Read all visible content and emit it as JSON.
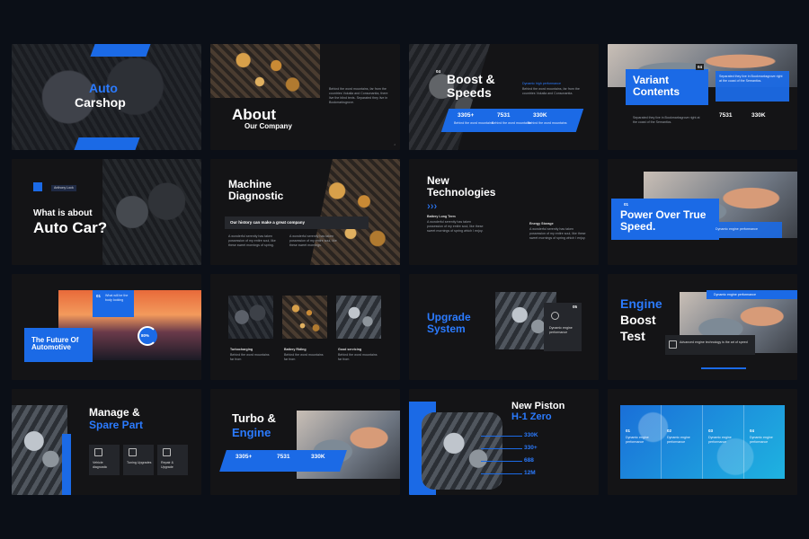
{
  "slides": {
    "s1": {
      "title1": "Auto",
      "title2": "Carshop"
    },
    "s2": {
      "title1": "About",
      "title2": "Our Company",
      "body": "Behind the word mountains, far from the countries Vokalia and Consonantia, there live the blind texts. Separated they live in Bookmarksgrove."
    },
    "s3": {
      "num": "04",
      "title": "Boost & Speeds",
      "sub": "Dynamic high performance",
      "body": "Behind the word mountains, far from the countries Vokalia and Consonantia.",
      "stats": [
        {
          "value": "3305+",
          "desc": "Behind the word mountains"
        },
        {
          "value": "7531",
          "desc": "Behind the word mountains"
        },
        {
          "value": "330K",
          "desc": "Behind the word mountains"
        }
      ]
    },
    "s4": {
      "num": "04",
      "title": "Variant Contents",
      "body": "Separated they live in Bookmarksgrove right at the coast of the Semantics.",
      "stat1": "7531",
      "stat2": "330K"
    },
    "s5": {
      "badge": "Anthony Lock",
      "title1": "What is about",
      "title2": "Auto Car?"
    },
    "s6": {
      "title": "Machine Diagnostic",
      "banner": "Our history can make a great company",
      "body1": "A wonderful serenity has taken possession of my entire soul, like these sweet mornings of spring.",
      "body2": "A wonderful serenity has taken possession of my entire soul, like these sweet mornings."
    },
    "s7": {
      "title": "New Technologies",
      "h1": "Battery Long Term",
      "h2": "Energy Storage",
      "body": "A wonderful serenity has taken possession of my entire soul, like these sweet mornings of spring which I enjoy."
    },
    "s8": {
      "num": "01",
      "title": "Power Over True Speed.",
      "side": "Dynamic engine performance"
    },
    "s9": {
      "num": "01",
      "sub": "What will be the body looking",
      "title": "The Future Of Automotive",
      "pct": "80%"
    },
    "s10": {
      "items": [
        "Turbocharging",
        "Battery Riding",
        "Good servicing"
      ],
      "body": "Behind the word mountains far from"
    },
    "s11": {
      "num": "05",
      "title": "Upgrade System",
      "box": "Dynamic engine performance"
    },
    "s12": {
      "num": "01",
      "tagline": "Dynamic engine performance",
      "title1": "Engine",
      "title2": "Boost",
      "title3": "Test",
      "box": "Advanced engine technology is the art of speed"
    },
    "s13": {
      "title1": "Manage &",
      "title2": "Spare Part",
      "icons": [
        "Vehicle diagnostic",
        "Tuning Upgrades",
        "Repair & Upgrade"
      ]
    },
    "s14": {
      "title1": "Turbo &",
      "title2": "Engine",
      "stats": [
        "3305+",
        "7531",
        "330K"
      ]
    },
    "s15": {
      "title1": "New Piston",
      "title2": "H-1 Zero",
      "stats": [
        "330K",
        "330+",
        "688",
        "12M"
      ]
    },
    "s16": {
      "cols": [
        {
          "n": "01",
          "t": "Dynamic engine performance"
        },
        {
          "n": "02",
          "t": "Dynamic engine performance"
        },
        {
          "n": "03",
          "t": "Dynamic engine performance"
        },
        {
          "n": "04",
          "t": "Dynamic engine performance"
        }
      ]
    }
  },
  "colors": {
    "accent": "#1b6ae6",
    "background": "#0b0f17",
    "slide": "#141416"
  }
}
